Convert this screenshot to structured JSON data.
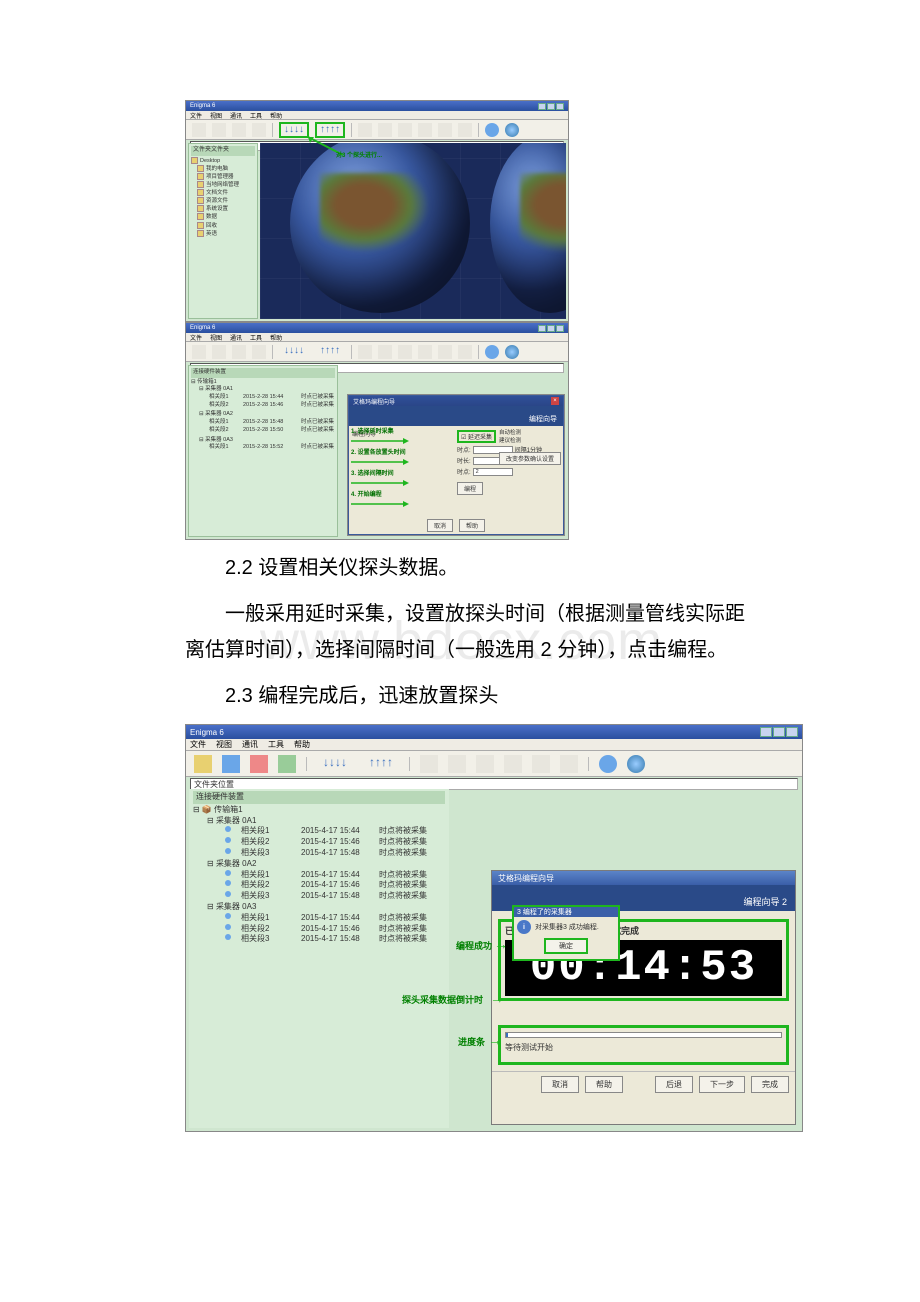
{
  "watermark": "www.bdocx.com",
  "section_22": "2.2 设置相关仪探头数据。",
  "para_22": "一般采用延时采集，设置放探头时间（根据测量管线实际距离估算时间），选择间隔时间（一般选用 2 分钟），点击编程。",
  "section_23": "2.3 编程完成后，迅速放置探头",
  "app_title": "Enigma 6",
  "menus": [
    "文件",
    "视图",
    "通讯",
    "工具",
    "帮助"
  ],
  "pathbar_label": "文件夹位置",
  "sidepanel1_header": "文件夹文件夹",
  "desktop_label": "Desktop",
  "desktop_items": [
    "我的电脑",
    "项目管理器",
    "当地网络管理",
    "文档文件",
    "资源文件",
    "系统设置",
    "数据",
    "回收",
    "英语"
  ],
  "shot1_anno": "对3 个探头进行...",
  "devices_header": "连接硬件装置",
  "box_root": "传输箱1",
  "collectors": [
    "采集器 0A1",
    "采集器 0A2",
    "采集器 0A3"
  ],
  "phases": [
    "相关段1",
    "相关段2",
    "相关段3"
  ],
  "phase_times_s2": [
    "2015-2-28 15:44",
    "2015-2-28 15:46",
    "2015-2-28 15:48",
    "2015-2-28 15:50",
    "2015-2-28 15:52"
  ],
  "status_done": "时点已被采集",
  "wiz_title_small": "艾格玛编程向导",
  "wiz_step_label_small": "编程向导",
  "wiz_section": "编程向导",
  "step1": "1. 选择延时采集",
  "step2": "2. 设置各放置头时间",
  "step3": "3. 选择间隔时间",
  "step4": "4. 开始编程",
  "btn_delay": "延迟采集",
  "lbl_delay_a": "时点:",
  "lbl_delay_b": "时长:",
  "sel_minute": "间隔1分钟",
  "combo_minutes": "2",
  "right_opt1": "自动检测",
  "right_opt2": "建议检测",
  "right_btn": "改变参数确认设置",
  "btn_start": "编程",
  "bottom_btns": [
    "取消",
    "帮助"
  ],
  "shot3": {
    "rows": [
      {
        "phase": "相关段1",
        "time": "2015-4-17 15:44",
        "status": "时点将被采集"
      },
      {
        "phase": "相关段2",
        "time": "2015-4-17 15:46",
        "status": "时点将被采集"
      },
      {
        "phase": "相关段3",
        "time": "2015-4-17 15:48",
        "status": "时点将被采集"
      }
    ],
    "wiz_title": "艾格玛编程向导",
    "step_title": "编程向导 2",
    "msg_title": "3 编程了的采集器",
    "msg_body": "对采集器3 成功编程.",
    "ok": "确定",
    "anno_success": "编程成功",
    "anno_countdown": "探头采集数据倒计时",
    "anno_progress": "进度条",
    "head_msg": "已设置的探头 - 正在等待测试完成",
    "lcd": "00:14:53",
    "wait_text": "等待测试开始",
    "buttons": [
      "取消",
      "帮助",
      "后退",
      "下一步",
      "完成"
    ]
  }
}
